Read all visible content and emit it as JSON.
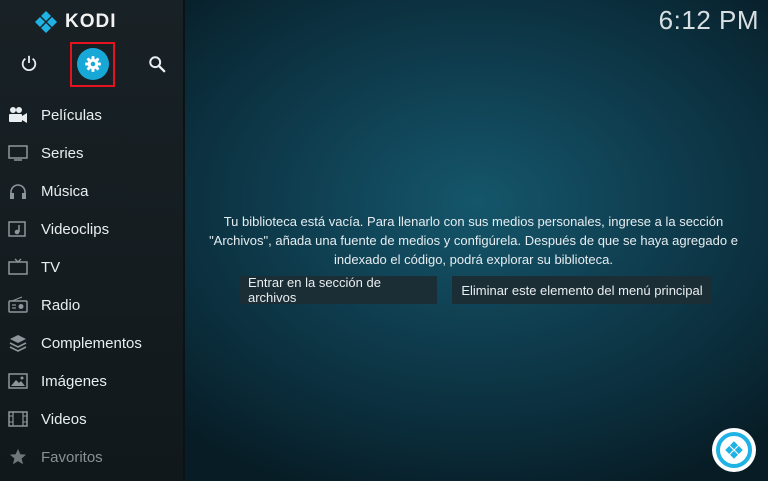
{
  "app": {
    "logo_text": "KODI"
  },
  "header": {
    "clock": "6:12 PM"
  },
  "topbar": {
    "power_icon": "power-icon",
    "settings_icon": "gear-icon",
    "search_icon": "search-icon"
  },
  "sidebar": {
    "items": [
      {
        "label": "Películas",
        "icon": "movies-icon"
      },
      {
        "label": "Series",
        "icon": "tv-shows-icon"
      },
      {
        "label": "Música",
        "icon": "headphones-icon"
      },
      {
        "label": "Videoclips",
        "icon": "music-video-icon"
      },
      {
        "label": "TV",
        "icon": "tv-icon"
      },
      {
        "label": "Radio",
        "icon": "radio-icon"
      },
      {
        "label": "Complementos",
        "icon": "addons-icon"
      },
      {
        "label": "Imágenes",
        "icon": "pictures-icon"
      },
      {
        "label": "Videos",
        "icon": "videos-icon"
      },
      {
        "label": "Favoritos",
        "icon": "star-icon"
      }
    ]
  },
  "main": {
    "message": "Tu biblioteca está vacía. Para llenarlo con sus medios personales, ingrese a la sección \"Archivos\", añada una fuente de medios y configúrela. Después de que se haya agregado e indexado el código, podrá explorar su biblioteca.",
    "buttons": {
      "files": "Entrar en la sección de archivos",
      "remove": "Eliminar este elemento del menú principal"
    }
  },
  "colors": {
    "accent": "#17a8d8",
    "highlight_border": "#e6121f",
    "sidebar_bg": "#161e22",
    "main_bg": "#0f3f51"
  }
}
